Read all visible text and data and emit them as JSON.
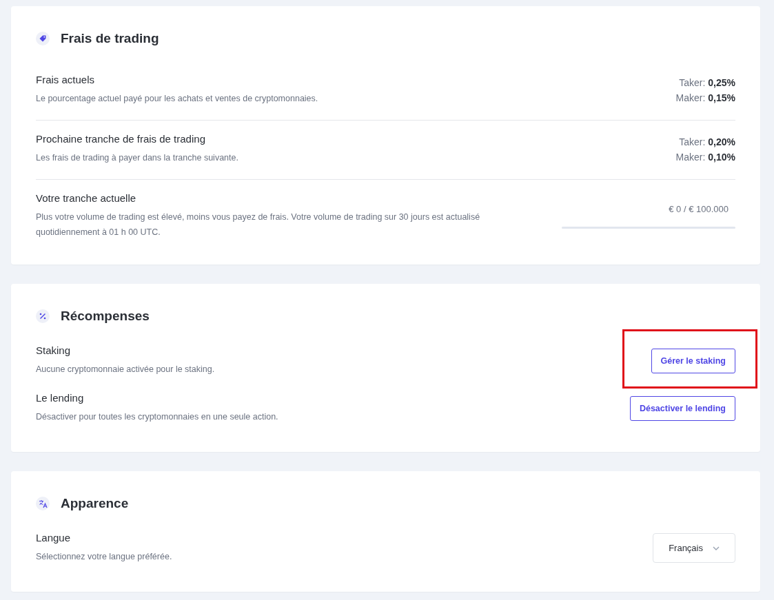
{
  "sections": [
    {
      "title": "Frais de trading",
      "rows": [
        {
          "kind": "rates",
          "title": "Frais actuels",
          "description": "Le pourcentage actuel payé pour les achats et ventes de cryptomonnaies.",
          "rates": [
            {
              "label": "Taker:",
              "value": "0,25%"
            },
            {
              "label": "Maker:",
              "value": "0,15%"
            }
          ]
        },
        {
          "kind": "rates",
          "title": "Prochaine tranche de frais de trading",
          "description": "Les frais de trading à payer dans la tranche suivante.",
          "rates": [
            {
              "label": "Taker:",
              "value": "0,20%"
            },
            {
              "label": "Maker:",
              "value": "0,10%"
            }
          ]
        },
        {
          "kind": "progress",
          "title": "Votre tranche actuelle",
          "description": "Plus votre volume de trading est élevé, moins vous payez de frais. Votre volume de trading sur 30 jours est actualisé quotidiennement à 01 h 00 UTC.",
          "reading": "€ 0 / € 100.000",
          "level": 0
        }
      ]
    },
    {
      "title": "Récompenses",
      "rows": [
        {
          "kind": "button",
          "title": "Staking",
          "description": "Aucune cryptomonnaie activée pour le staking.",
          "button": "Gérer le staking",
          "highlighted": true
        },
        {
          "kind": "button",
          "title": "Le lending",
          "description": "Désactiver pour toutes les cryptomonnaies en une seule action.",
          "button": "Désactiver le lending",
          "highlighted": false
        }
      ]
    },
    {
      "title": "Apparence",
      "rows": [
        {
          "kind": "select",
          "title": "Langue",
          "description": "Sélectionnez votre langue préférée.",
          "value": "Français"
        }
      ]
    }
  ]
}
